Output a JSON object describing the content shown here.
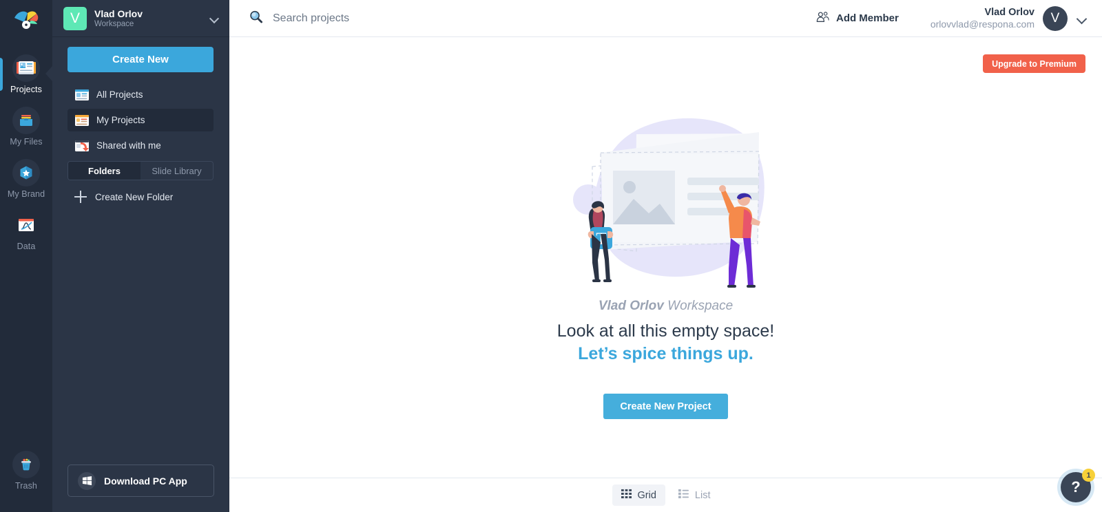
{
  "rail": {
    "logo_icon": "app-logo-icon",
    "items": [
      {
        "label": "Projects",
        "icon": "projects-icon",
        "active": true
      },
      {
        "label": "My Files",
        "icon": "my-files-icon",
        "active": false
      },
      {
        "label": "My Brand",
        "icon": "my-brand-icon",
        "active": false
      },
      {
        "label": "Data",
        "icon": "data-icon",
        "active": false
      }
    ],
    "trash": {
      "label": "Trash",
      "icon": "trash-icon"
    }
  },
  "sidebar": {
    "workspace": {
      "avatar_letter": "V",
      "name": "Vlad Orlov",
      "subtitle": "Workspace",
      "chevron_icon": "chevron-down-icon",
      "avatar_color": "#5EE8B5"
    },
    "create_new_label": "Create New",
    "nav": [
      {
        "label": "All Projects",
        "icon": "all-projects-icon",
        "active": false
      },
      {
        "label": "My Projects",
        "icon": "my-projects-icon",
        "active": true
      },
      {
        "label": "Shared with me",
        "icon": "shared-with-me-icon",
        "active": false
      }
    ],
    "segmented": {
      "options": [
        "Folders",
        "Slide Library"
      ],
      "selected": "Folders"
    },
    "create_folder_label": "Create New Folder",
    "download": {
      "label": "Download PC App",
      "icon": "windows-icon"
    }
  },
  "topbar": {
    "search": {
      "placeholder": "Search projects",
      "value": "",
      "icon": "search-icon"
    },
    "add_member": {
      "label": "Add Member",
      "icon": "add-member-icon"
    },
    "user": {
      "name": "Vlad Orlov",
      "email": "orlovvlad@respona.com",
      "avatar_letter": "V",
      "chevron_icon": "chevron-down-icon"
    }
  },
  "main": {
    "upgrade_label": "Upgrade to Premium",
    "empty_state": {
      "workspace_prefix": "Vlad Orlov",
      "workspace_suffix": " Workspace",
      "headline": "Look at all this empty space!",
      "subheadline": "Let’s spice things up.",
      "cta_label": "Create New Project",
      "illustration_icon": "empty-projects-illustration"
    },
    "view_toggle": {
      "options": [
        {
          "label": "Grid",
          "icon": "grid-view-icon",
          "active": true
        },
        {
          "label": "List",
          "icon": "list-view-icon",
          "active": false
        }
      ]
    },
    "help": {
      "glyph": "?",
      "badge_count": "1",
      "icon": "help-icon"
    }
  },
  "colors": {
    "rail_bg": "#222B3A",
    "sidebar_bg": "#2B3546",
    "accent_blue": "#3BA7DC",
    "upgrade_red": "#F1614A",
    "workspace_green": "#5EE8B5",
    "badge_yellow": "#F7D038"
  }
}
